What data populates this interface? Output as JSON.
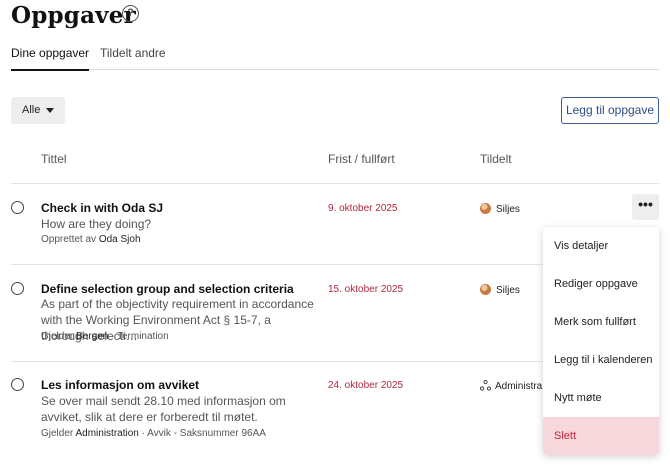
{
  "header": {
    "title": "Oppgaver",
    "help_icon": "?"
  },
  "tabs": [
    {
      "label": "Dine oppgaver",
      "active": true
    },
    {
      "label": "Tildelt andre",
      "active": false
    }
  ],
  "toolbar": {
    "filter_value": "Alle",
    "add_label": "Legg til oppgave"
  },
  "columns": {
    "title": "Tittel",
    "due": "Frist / fullført",
    "assigned": "Tildelt"
  },
  "tasks": [
    {
      "title": "Check in with Oda SJ",
      "description": "How are they doing?",
      "meta_prefix": "Opprettet av",
      "meta_strong": "Oda Sjoh",
      "meta_suffix": "",
      "due": "9. oktober 2025",
      "assignee": "Siljes",
      "assignee_icon": "avatar"
    },
    {
      "title": "Define selection group and selection criteria",
      "description": "As part of the objectivity requirement in accordance with the Working Environment Act § 15-7, a thorough selecti…",
      "meta_prefix": "Gjelder",
      "meta_strong": "Bergen",
      "meta_suffix": "· Termination",
      "due": "15. oktober 2025",
      "assignee": "Siljes",
      "assignee_icon": "avatar"
    },
    {
      "title": "Les informasjon om avviket",
      "description": "Se over mail sendt 28.10 med informasjon om avviket, slik at dere er forberedt til møtet.",
      "meta_prefix": "Gjelder",
      "meta_strong": "Administration",
      "meta_suffix": "· Avvik - Saksnummer 96AA",
      "due": "24. oktober 2025",
      "assignee": "Administra",
      "assignee_icon": "group-icon"
    }
  ],
  "more_button": "•••",
  "menu": [
    {
      "label": "Vis detaljer"
    },
    {
      "label": "Rediger oppgave"
    },
    {
      "label": "Merk som fullført"
    },
    {
      "label": "Legg til i kalenderen"
    },
    {
      "label": "Nytt møte"
    },
    {
      "label": "Slett",
      "danger": true
    }
  ],
  "colors": {
    "accent": "#2c4d86",
    "due": "#b0283c",
    "danger_bg": "#f6d8dc",
    "danger_text": "#c0243c"
  }
}
